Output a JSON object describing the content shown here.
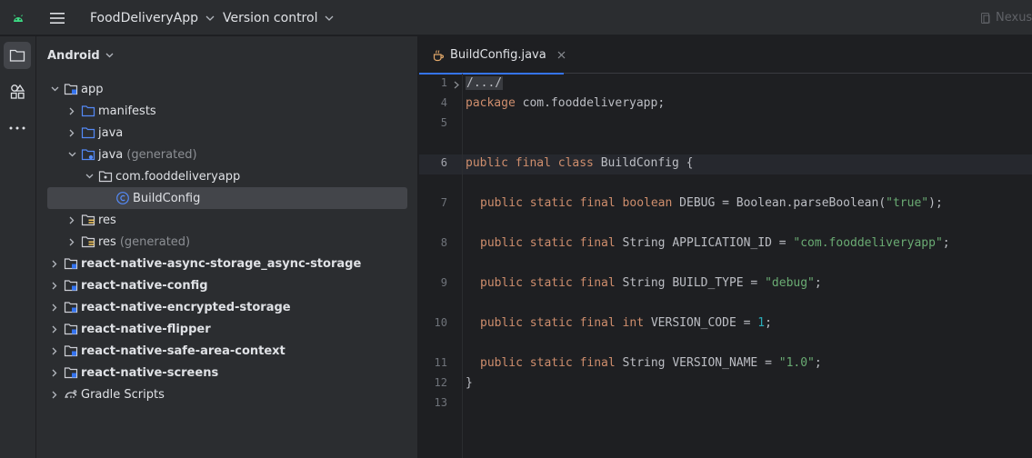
{
  "topbar": {
    "project_name": "FoodDeliveryApp",
    "vcs_label": "Version control",
    "device_label": "Nexus"
  },
  "project_panel": {
    "title": "Android",
    "tree": [
      {
        "label": "app",
        "gen": "",
        "bold": false
      },
      {
        "label": "manifests",
        "gen": "",
        "bold": false
      },
      {
        "label": "java",
        "gen": "",
        "bold": false
      },
      {
        "label": "java",
        "gen": "(generated)",
        "bold": false
      },
      {
        "label": "com.fooddeliveryapp",
        "gen": "",
        "bold": false
      },
      {
        "label": "BuildConfig",
        "gen": "",
        "bold": false
      },
      {
        "label": "res",
        "gen": "",
        "bold": false
      },
      {
        "label": "res",
        "gen": "(generated)",
        "bold": false
      },
      {
        "label": "react-native-async-storage_async-storage",
        "gen": "",
        "bold": true
      },
      {
        "label": "react-native-config",
        "gen": "",
        "bold": true
      },
      {
        "label": "react-native-encrypted-storage",
        "gen": "",
        "bold": true
      },
      {
        "label": "react-native-flipper",
        "gen": "",
        "bold": true
      },
      {
        "label": "react-native-safe-area-context",
        "gen": "",
        "bold": true
      },
      {
        "label": "react-native-screens",
        "gen": "",
        "bold": true
      },
      {
        "label": "Gradle Scripts",
        "gen": "",
        "bold": false
      }
    ]
  },
  "editor": {
    "tab_label": "BuildConfig.java",
    "line_numbers": [
      "1",
      "4",
      "5",
      "6",
      "7",
      "8",
      "9",
      "10",
      "11",
      "12",
      "13"
    ],
    "lines": {
      "folded": "/.../",
      "package_kw": "package",
      "package_name": " com.fooddeliveryapp;",
      "class_kw": "public final class",
      "class_name": " BuildConfig {",
      "mods": "public static final",
      "debug_type": " boolean",
      "debug_rest": " DEBUG = Boolean.parseBoolean(",
      "debug_str": "\"true\"",
      "debug_end": ");",
      "string_type": " String",
      "appid_rest": " APPLICATION_ID = ",
      "appid_str": "\"com.fooddeliveryapp\"",
      "semi": ";",
      "buildtype_rest": " BUILD_TYPE = ",
      "buildtype_str": "\"debug\"",
      "int_type": " int",
      "vcode_rest": " VERSION_CODE = ",
      "vcode_num": "1",
      "vname_rest": " VERSION_NAME = ",
      "vname_str": "\"1.0\"",
      "close_brace": "}"
    }
  },
  "colors": {
    "accent": "#3574f0",
    "keyword": "#cf8e6d",
    "string": "#6aab73",
    "number": "#2aacb8"
  }
}
